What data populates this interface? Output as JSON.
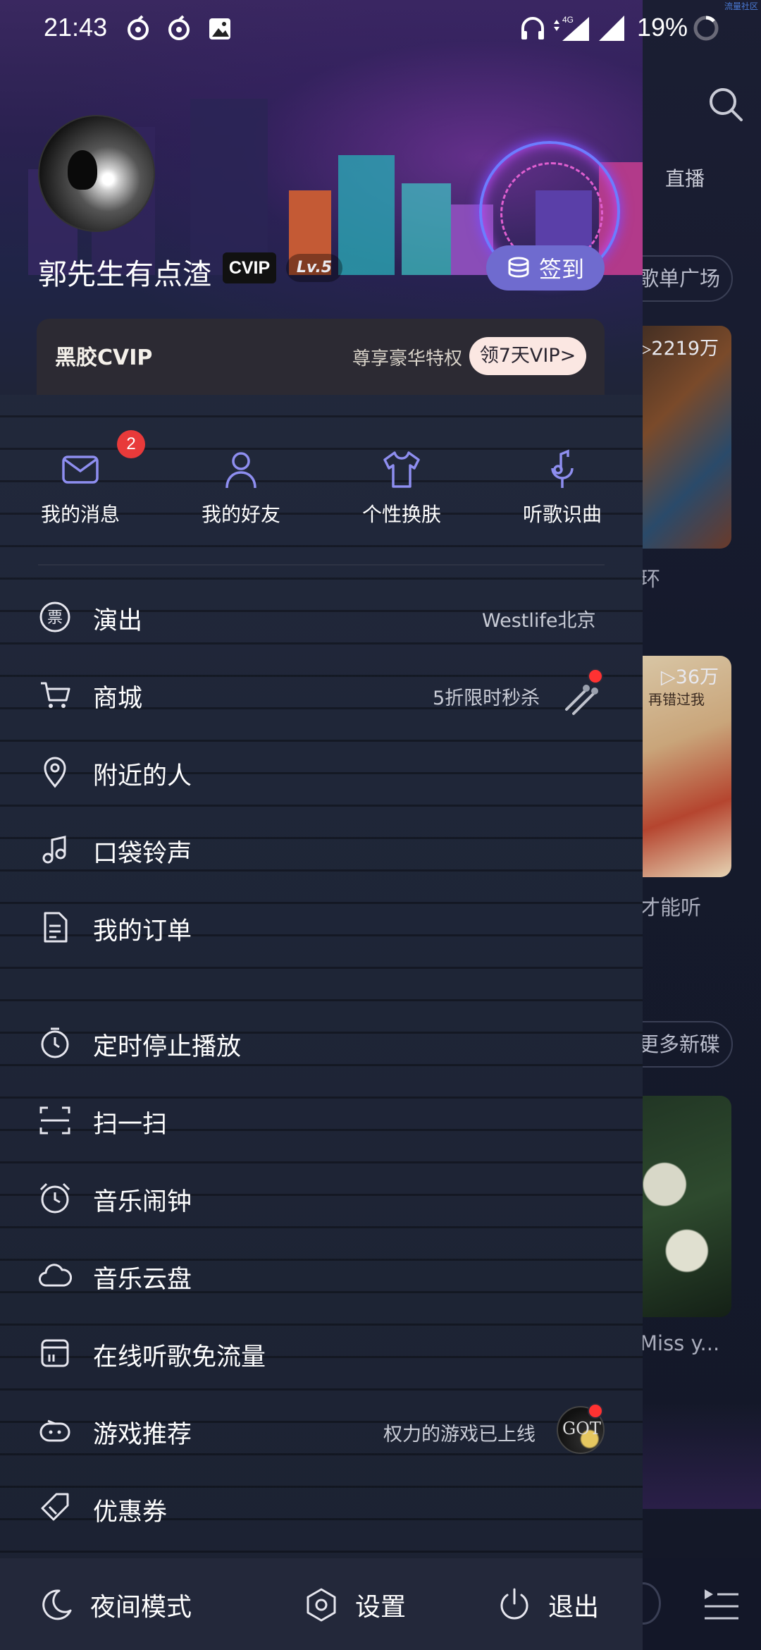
{
  "status_bar": {
    "time": "21:43",
    "battery": "19%",
    "network": "4G"
  },
  "background_app": {
    "tab_live": "直播",
    "playlist_square": "歌单广场",
    "card1_plays": "▷2219万",
    "card1_title_fragment": "环",
    "card2_plays": "▷36万",
    "card2_caption": "再错过我",
    "card2_title_fragment": "才能听",
    "more_albums": "更多新碟",
    "card3_title_fragment": "Miss y...",
    "corner_tag": "流量社区"
  },
  "profile": {
    "username": "郭先生有点渣",
    "vip_badge": "CVIP",
    "level": "Lv.5",
    "signin_label": "签到"
  },
  "vip_banner": {
    "logo": "黑胶CVIP",
    "perk_text": "尊享豪华特权",
    "cta": "领7天VIP>"
  },
  "quick_actions": [
    {
      "label": "我的消息",
      "icon": "mail-icon",
      "badge": "2"
    },
    {
      "label": "我的好友",
      "icon": "person-icon"
    },
    {
      "label": "个性换肤",
      "icon": "tshirt-icon"
    },
    {
      "label": "听歌识曲",
      "icon": "mic-note-icon"
    }
  ],
  "menu": [
    {
      "label": "演出",
      "icon": "ticket-icon",
      "extra": "Westlife北京"
    },
    {
      "label": "商城",
      "icon": "cart-icon",
      "extra": "5折限时秒杀"
    },
    {
      "label": "附近的人",
      "icon": "location-pin-icon"
    },
    {
      "label": "口袋铃声",
      "icon": "music-note-icon"
    },
    {
      "label": "我的订单",
      "icon": "document-icon"
    },
    {
      "label": "定时停止播放",
      "icon": "timer-icon"
    },
    {
      "label": "扫一扫",
      "icon": "scan-icon"
    },
    {
      "label": "音乐闹钟",
      "icon": "alarm-clock-icon"
    },
    {
      "label": "音乐云盘",
      "icon": "cloud-icon"
    },
    {
      "label": "在线听歌免流量",
      "icon": "sim-card-icon"
    },
    {
      "label": "游戏推荐",
      "icon": "gamepad-icon",
      "extra": "权力的游戏已上线",
      "thumb_text": "GOT"
    },
    {
      "label": "优惠券",
      "icon": "coupon-icon"
    }
  ],
  "bottom_bar": {
    "night_mode": "夜间模式",
    "settings": "设置",
    "logout": "退出"
  },
  "colors": {
    "accent_purple": "#6f6bcf",
    "icon_lilac": "#8e8ef0",
    "badge_red": "#e83a3a",
    "vip_cta_bg": "#fbe7e2"
  }
}
